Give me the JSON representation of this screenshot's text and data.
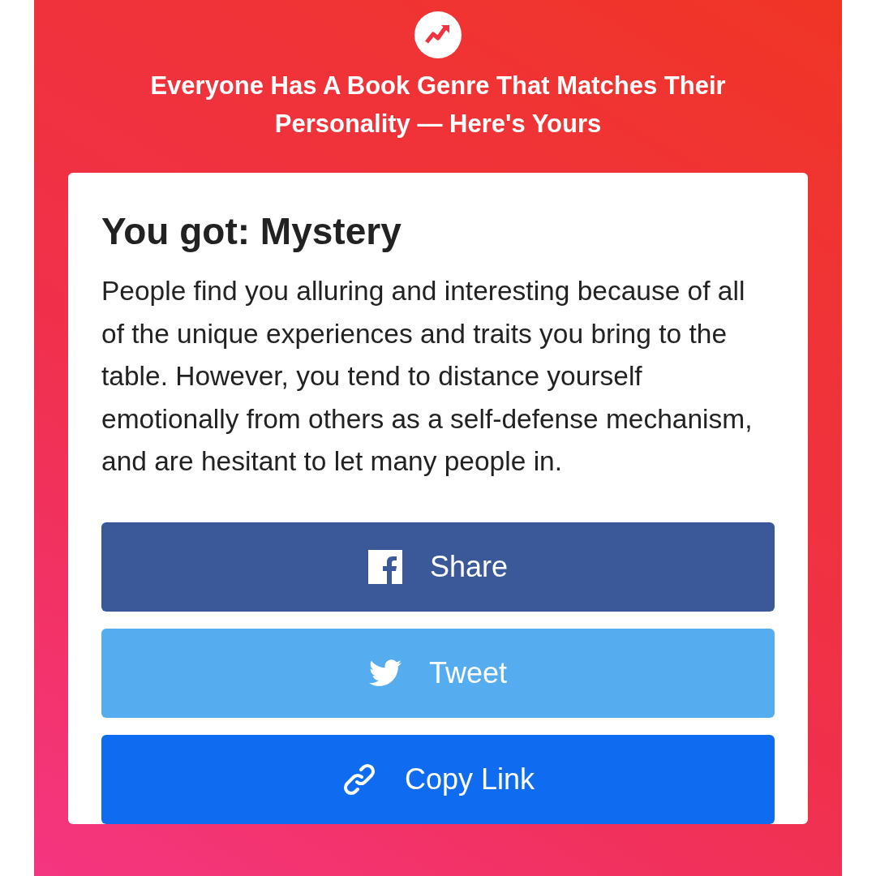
{
  "quiz_title": "Everyone Has A Book Genre That Matches Their Personality — Here's Yours",
  "result": {
    "heading": "You got: Mystery",
    "description": "People find you alluring and interesting because of all of the unique experiences and traits you bring to the table. However, you tend to distance yourself emotionally from others as a self-defense mechanism, and are hesitant to let many people in."
  },
  "share_buttons": [
    {
      "kind": "facebook",
      "label": "Share"
    },
    {
      "kind": "twitter",
      "label": "Tweet"
    },
    {
      "kind": "link",
      "label": "Copy Link"
    }
  ]
}
